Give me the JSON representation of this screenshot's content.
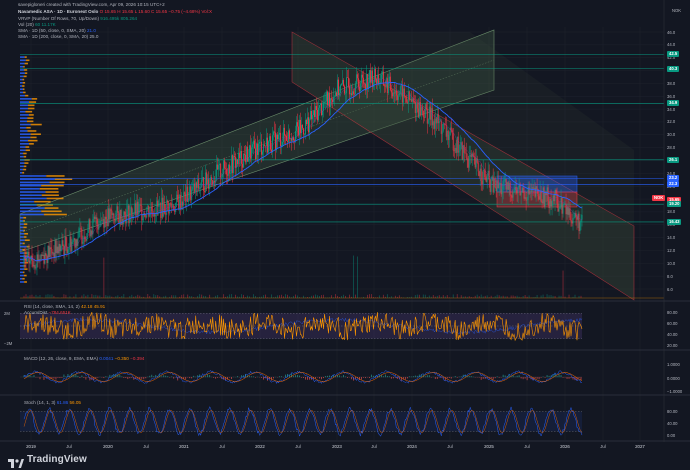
{
  "header": {
    "created_by": "savepigloneri created with TradingView.com, Apr 09, 2026 10:15 UTC+2",
    "symbol_line": "Navamedic ASA · 1D · Euronext Oslo",
    "ohlc": "O 15.65  H 15.65  L 15.60  C 15.65  −0.75 (−4.68%)",
    "vol_flag": "Vol:X",
    "vrvp": "VRVP (Number Of Rows, 70, Up/Down)",
    "vrvp_values": "916.495k  805.264",
    "vol": "Vol (20)",
    "vol_value": "60  11.17K",
    "sma_1d_50": "SMA · 1D (50, close, 0, SMA, 20)",
    "sma_1d_50_value": "21.0",
    "sma_1d_200": "SMA · 1D (200, close, 0, SMA, 20)",
    "sma_1d_200_value": "25.0"
  },
  "currency": "NOK",
  "price_axis": [
    "46.0",
    "44.0",
    "42.0",
    "40.0",
    "38.0",
    "36.0",
    "34.0",
    "32.0",
    "30.0",
    "28.0",
    "26.0",
    "24.0",
    "22.0",
    "20.0",
    "18.0",
    "16.0",
    "14.0",
    "12.0",
    "10.0",
    "8.0",
    "6.0"
  ],
  "price_tags": [
    {
      "label": "42.5",
      "color": "#089981"
    },
    {
      "label": "40.3",
      "color": "#089981"
    },
    {
      "label": "34.9",
      "color": "#089981"
    },
    {
      "label": "26.1",
      "color": "#089981"
    },
    {
      "label": "23.2",
      "color": "#2962ff"
    },
    {
      "label": "22.3",
      "color": "#2962ff"
    },
    {
      "label": "NOK",
      "color": "#f23645"
    },
    {
      "label": "15.65",
      "color": "#f23645"
    },
    {
      "label": "19.20",
      "color": "#089981"
    },
    {
      "label": "16.43",
      "color": "#089981"
    }
  ],
  "rsi": {
    "title": "RSI (14, close, SMA, 14, 2)",
    "value1": "42.18",
    "value2": "45.91",
    "accum_title": "Accum/Dist",
    "accum_value": "−784.651K",
    "axis": [
      "80.00",
      "60.00",
      "40.00",
      "20.00"
    ],
    "left_axis": [
      "2M",
      "−2M"
    ]
  },
  "macd": {
    "title": "MACD (12, 26, close, 9, EMA, EMA)",
    "value1": "0.0041",
    "value2": "−0.350",
    "value3": "−0.394",
    "axis": [
      "1.0000",
      "0.0000",
      "−1.0000"
    ]
  },
  "stoch": {
    "title": "Stoch (14, 1, 3)",
    "value1": "61.86",
    "value2": "56.05",
    "axis": [
      "80.00",
      "40.00",
      "0.00"
    ]
  },
  "time_axis": [
    "2019",
    "Jul",
    "2020",
    "Jul",
    "2021",
    "Jul",
    "2022",
    "Jul",
    "2023",
    "Jul",
    "2024",
    "Jul",
    "2025",
    "Jul",
    "2026",
    "Jul",
    "2027"
  ],
  "brand": "TradingView",
  "colors": {
    "background": "#131722",
    "up": "#089981",
    "down": "#f23645",
    "sma_blue": "#2962ff",
    "rsi": "#ff9800",
    "channel_green": "#2a3d2a"
  }
}
